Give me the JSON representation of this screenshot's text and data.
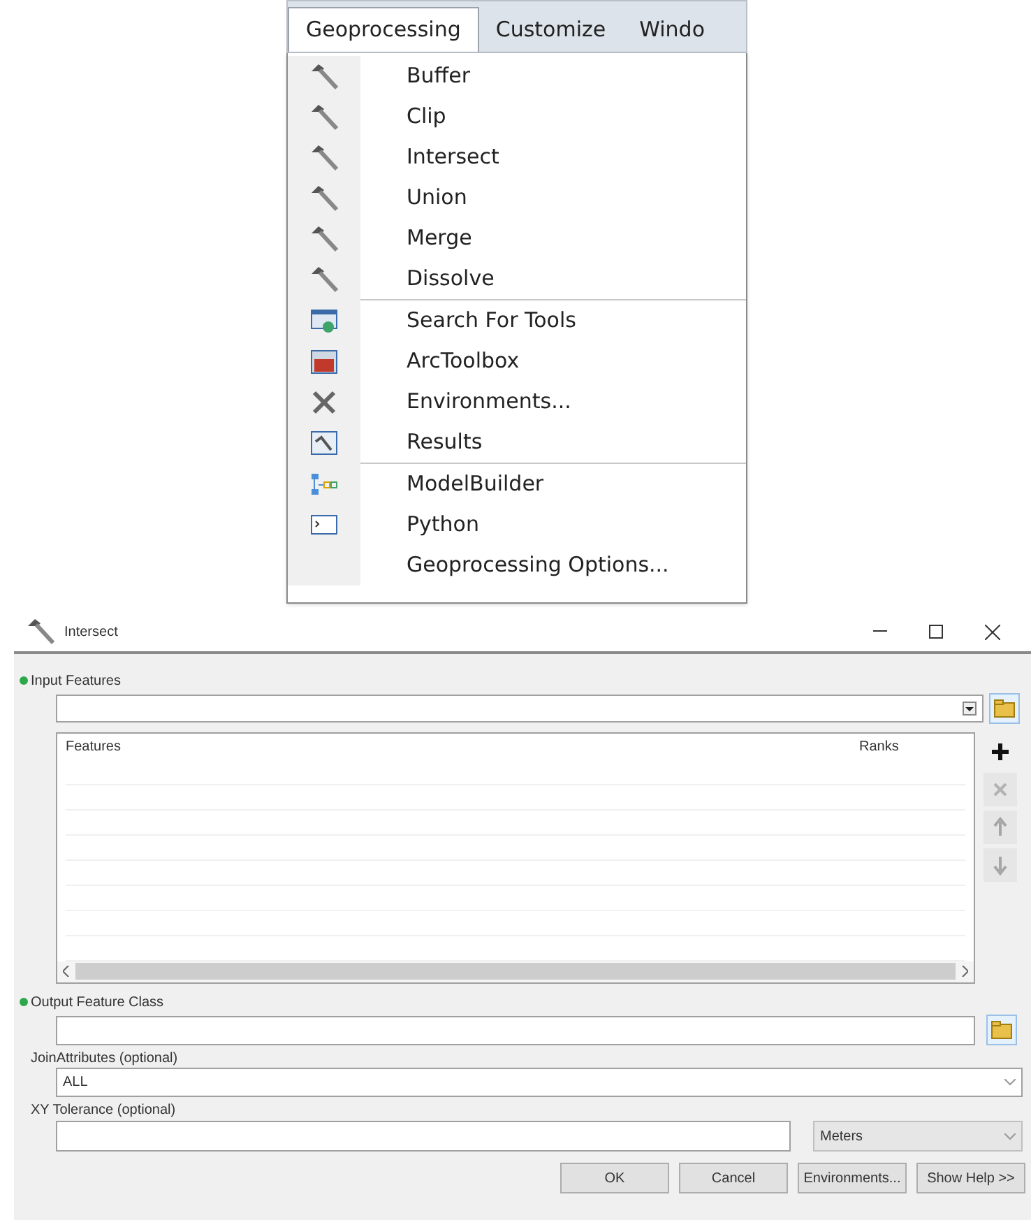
{
  "menu_bar": {
    "tabs": [
      {
        "label": "Geoprocessing",
        "selected": true
      },
      {
        "label": "Customize",
        "selected": false
      },
      {
        "label": "Windo",
        "selected": false
      }
    ]
  },
  "menu": {
    "groups": [
      [
        {
          "label": "Buffer",
          "kind": "tool"
        },
        {
          "label": "Clip",
          "kind": "tool"
        },
        {
          "label": "Intersect",
          "kind": "tool"
        },
        {
          "label": "Union",
          "kind": "tool"
        },
        {
          "label": "Merge",
          "kind": "tool"
        },
        {
          "label": "Dissolve",
          "kind": "tool"
        }
      ],
      [
        {
          "label": "Search For Tools",
          "kind": "search"
        },
        {
          "label": "ArcToolbox",
          "kind": "toolbox"
        },
        {
          "label": "Environments...",
          "kind": "environments"
        },
        {
          "label": "Results",
          "kind": "results"
        }
      ],
      [
        {
          "label": "ModelBuilder",
          "kind": "model"
        },
        {
          "label": "Python",
          "kind": "python"
        },
        {
          "label": "Geoprocessing Options...",
          "kind": "plain"
        }
      ]
    ]
  },
  "dialog": {
    "title": "Intersect",
    "input_features": {
      "label": "Input Features",
      "required": true,
      "columns": [
        "Features",
        "Ranks"
      ],
      "side_buttons": [
        {
          "kind": "add",
          "disabled": false
        },
        {
          "kind": "remove",
          "disabled": true
        },
        {
          "kind": "up",
          "disabled": true
        },
        {
          "kind": "down",
          "disabled": true
        }
      ]
    },
    "output_feature_class": {
      "label": "Output Feature Class",
      "required": true
    },
    "join_attributes": {
      "label": "JoinAttributes (optional)",
      "value": "ALL"
    },
    "xy_tolerance": {
      "label": "XY Tolerance (optional)",
      "unit": "Meters"
    },
    "buttons": [
      "OK",
      "Cancel",
      "Environments...",
      "Show Help >>"
    ]
  }
}
